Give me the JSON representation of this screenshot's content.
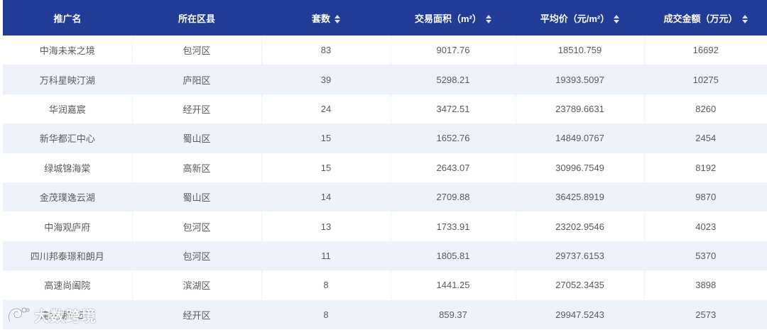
{
  "columns": [
    {
      "label": "推广名",
      "sortable": false
    },
    {
      "label": "所在区县",
      "sortable": false
    },
    {
      "label": "套数",
      "sortable": true
    },
    {
      "label": "交易面积（m²）",
      "sortable": true
    },
    {
      "label": "平均价（元/m²）",
      "sortable": true
    },
    {
      "label": "成交金额（万元）",
      "sortable": true
    }
  ],
  "rows": [
    [
      "中海未来之境",
      "包河区",
      "83",
      "9017.76",
      "18510.759",
      "16692"
    ],
    [
      "万科星映汀湖",
      "庐阳区",
      "39",
      "5298.21",
      "19393.5097",
      "10275"
    ],
    [
      "华润嘉宸",
      "经开区",
      "24",
      "3472.51",
      "23789.6631",
      "8260"
    ],
    [
      "新华都汇中心",
      "蜀山区",
      "15",
      "1652.76",
      "14849.0767",
      "2454"
    ],
    [
      "绿城锦海棠",
      "高新区",
      "15",
      "2643.07",
      "30996.7549",
      "8192"
    ],
    [
      "金茂璞逸云湖",
      "蜀山区",
      "14",
      "2709.88",
      "36425.8919",
      "9870"
    ],
    [
      "中海观庐府",
      "包河区",
      "13",
      "1733.91",
      "23202.9546",
      "4023"
    ],
    [
      "四川邦泰璟和朗月",
      "包河区",
      "11",
      "1805.81",
      "29737.6153",
      "5370"
    ],
    [
      "高速尚阖院",
      "滨湖区",
      "8",
      "1441.25",
      "27052.3435",
      "3898"
    ],
    [
      "建发湖畔云璟",
      "经开区",
      "8",
      "859.37",
      "29947.5243",
      "2573"
    ]
  ],
  "watermark": {
    "text": "大数跨境"
  },
  "colors": {
    "header_bg": "#213c96",
    "row_alt": "#eef2fb",
    "text": "#5a5a5a"
  }
}
